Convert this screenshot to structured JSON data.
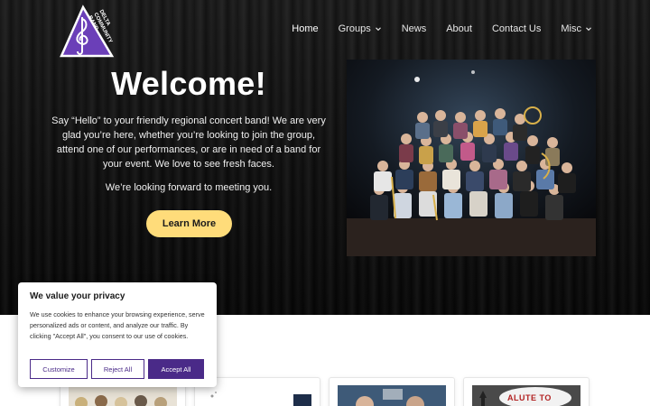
{
  "site": {
    "logo_text": "DELTA COMMUNITY BAND"
  },
  "nav": {
    "items": [
      {
        "label": "Home",
        "active": true,
        "has_dropdown": false
      },
      {
        "label": "Groups",
        "active": false,
        "has_dropdown": true
      },
      {
        "label": "News",
        "active": false,
        "has_dropdown": false
      },
      {
        "label": "About",
        "active": false,
        "has_dropdown": false
      },
      {
        "label": "Contact Us",
        "active": false,
        "has_dropdown": false
      },
      {
        "label": "Misc",
        "active": false,
        "has_dropdown": true
      }
    ]
  },
  "hero": {
    "title": "Welcome!",
    "paragraph": "Say “Hello” to your friendly regional concert band! We are very glad you’re here, whether you’re looking to join the group, attend one of our performances, or are in need of a band for your event. We love to see fresh faces.",
    "paragraph2": "We’re looking forward to meeting you.",
    "cta_label": "Learn More"
  },
  "cookie": {
    "title": "We value your privacy",
    "text": "We use cookies to enhance your browsing experience, serve personalized ads or content, and analyze our traffic. By clicking \"Accept All\", you consent to our use of cookies.",
    "customize_label": "Customize",
    "reject_label": "Reject All",
    "accept_label": "Accept All"
  },
  "cards": {
    "card4_text": "ALUTE TO"
  },
  "colors": {
    "accent_purple": "#4a2a88",
    "cta_yellow": "#ffdc7a",
    "hero_bg": "#111111"
  },
  "icons": [
    "chevron-down-icon",
    "treble-clef-icon"
  ]
}
